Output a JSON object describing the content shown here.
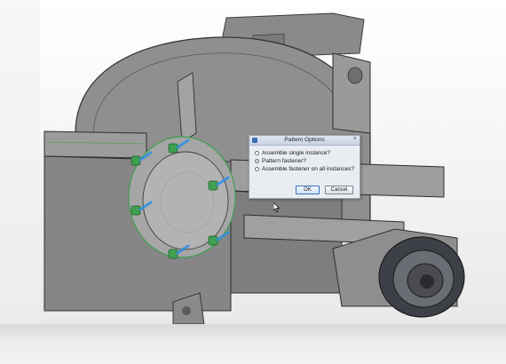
{
  "dialog": {
    "title": "Pattern Options",
    "close_glyph": "×",
    "options": [
      {
        "label": "Assemble single instance?",
        "selected": false
      },
      {
        "label": "Pattern fastener?",
        "selected": true
      },
      {
        "label": "Assemble fastener on all instances?",
        "selected": false
      }
    ],
    "ok_label": "OK",
    "cancel_label": "Cancel"
  },
  "icons": {
    "app": "app-icon",
    "close": "close-icon",
    "cursor": "mouse-pointer-icon"
  },
  "colors": {
    "model_gray": "#8c8c8c",
    "fastener_green": "#3fa050",
    "highlight_blue": "#2f8fe0"
  }
}
